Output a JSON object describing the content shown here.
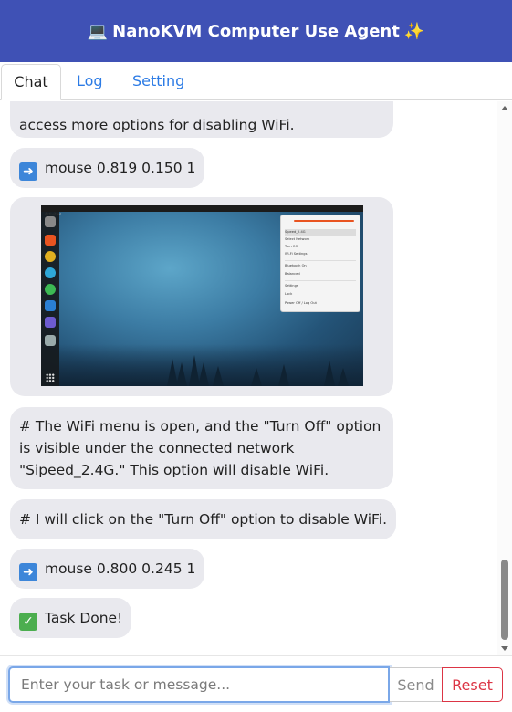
{
  "header": {
    "icon": "laptop-icon",
    "title": "NanoKVM Computer Use Agent",
    "sparkle_icon": "sparkles-icon",
    "color": "#3f51b5"
  },
  "tabs": [
    {
      "label": "Chat",
      "active": true
    },
    {
      "label": "Log",
      "active": false
    },
    {
      "label": "Setting",
      "active": false
    }
  ],
  "messages": {
    "m1_line2": "access more options for disabling WiFi.",
    "m2": "mouse 0.819 0.150 1",
    "m4": "# The WiFi menu is open, and the \"Turn Off\" option is visible under the connected network \"Sipeed_2.4G.\" This option will disable WiFi.",
    "m5": "# I will click on the \"Turn Off\" option to disable WiFi.",
    "m6": "mouse 0.800 0.245 1",
    "m7": "Task Done!"
  },
  "screenshot": {
    "activities": "Activities",
    "menu_items": [
      "Sipeed_2.4G",
      "Select Network",
      "Turn Off",
      "Wi-Fi Settings",
      "Bluetooth On",
      "Balanced",
      "Settings",
      "Lock",
      "Power Off / Log Out"
    ]
  },
  "input": {
    "placeholder": "Enter your task or message...",
    "send_label": "Send",
    "reset_label": "Reset"
  }
}
